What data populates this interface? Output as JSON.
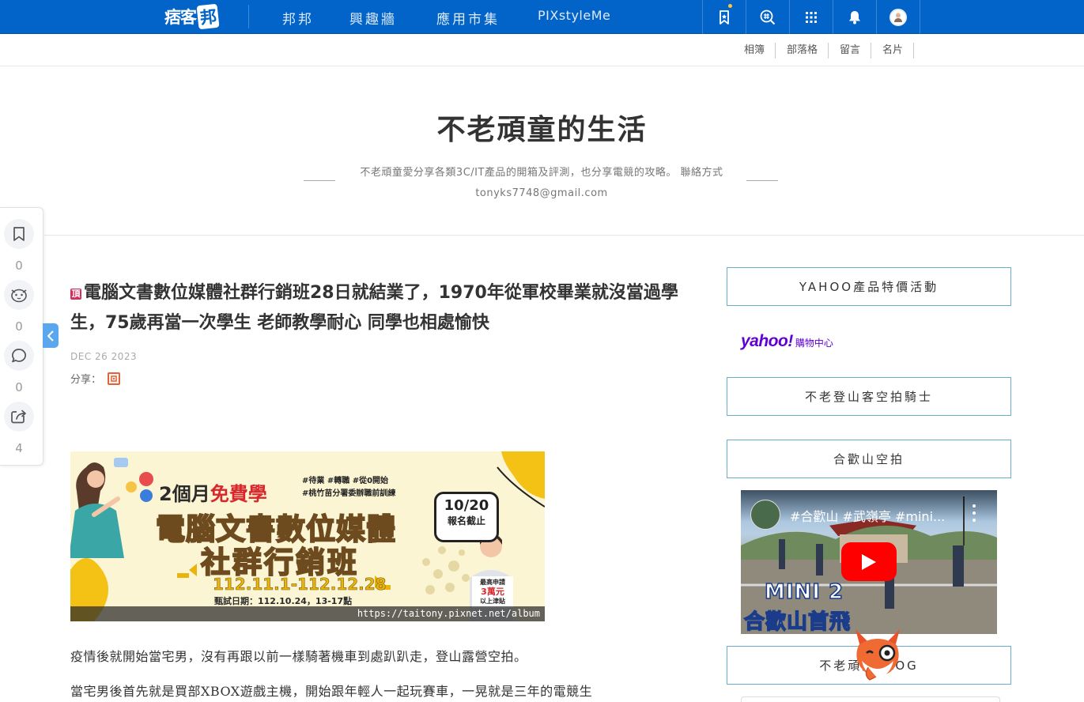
{
  "topbar": {
    "logo_text": "痞客",
    "logo_badge": "邦",
    "nav": [
      "邦邦",
      "興趣牆",
      "應用市集",
      "PIXstyleMe"
    ]
  },
  "subnav": [
    "相簿",
    "部落格",
    "留言",
    "名片"
  ],
  "blog": {
    "title": "不老頑童的生活",
    "description": "不老頑童愛分享各類3C/IT產品的開箱及評測，也分享電競的攻略。 聯絡方式 tonyks7748@gmail.com"
  },
  "side_panel": {
    "bookmark_count": "0",
    "reaction_count": "0",
    "comment_count": "0",
    "share_count": "4"
  },
  "article": {
    "pin_label": "頂",
    "title": "電腦文書數位媒體社群行銷班28日就結業了，1970年從軍校畢業就沒當過學生，75歲再當一次學生 老師教學耐心 同學也相處愉快",
    "date": "DEC 26 2023",
    "share_label": "分享：",
    "paragraphs": [
      "疫情後就開始當宅男，沒有再跟以前一樣騎著機車到處趴趴走，登山露營空拍。",
      "當宅男後首先就是買部XBOX遊戲主機，開始跟年輕人一起玩賽車，一晃就是三年的電競生"
    ]
  },
  "banner": {
    "free_prefix": "2個月",
    "free_highlight": "免費學",
    "tags": [
      "#待業 #轉職 #從0開始",
      "#桃竹苗分署委辦職前訓練"
    ],
    "line1": "電腦文書數位媒體",
    "line2": "社群行銷班",
    "dates": "112.11.1-112.12.28",
    "exam": "甄試日期：112.10.24，13-17點",
    "deadline_date": "10/20",
    "deadline_label": "報名截止",
    "sign_top": "最高申請",
    "sign_amount": "3萬元",
    "sign_bottom": "以上津貼",
    "caption": "https://taitony.pixnet.net/album"
  },
  "sidebar": {
    "box1": "YAHOO產品特價活動",
    "yahoo_logo": "yahoo!",
    "yahoo_sub": "購物中心",
    "box2": "不老登山客空拍騎士",
    "box3": "合歡山空拍",
    "video_title": "#合歡山 #武嶺亭 #mini...",
    "video_line1": "MINI 2",
    "video_line2": "合歡山首飛",
    "box4": "不老頑童BLOG"
  },
  "colors": {
    "topbar": "#0264c8",
    "accent_box_border": "#6aaecd",
    "collapse_tab": "#5aa7f0",
    "yahoo_purple": "#6001d2",
    "youtube_red": "#ff0000"
  }
}
